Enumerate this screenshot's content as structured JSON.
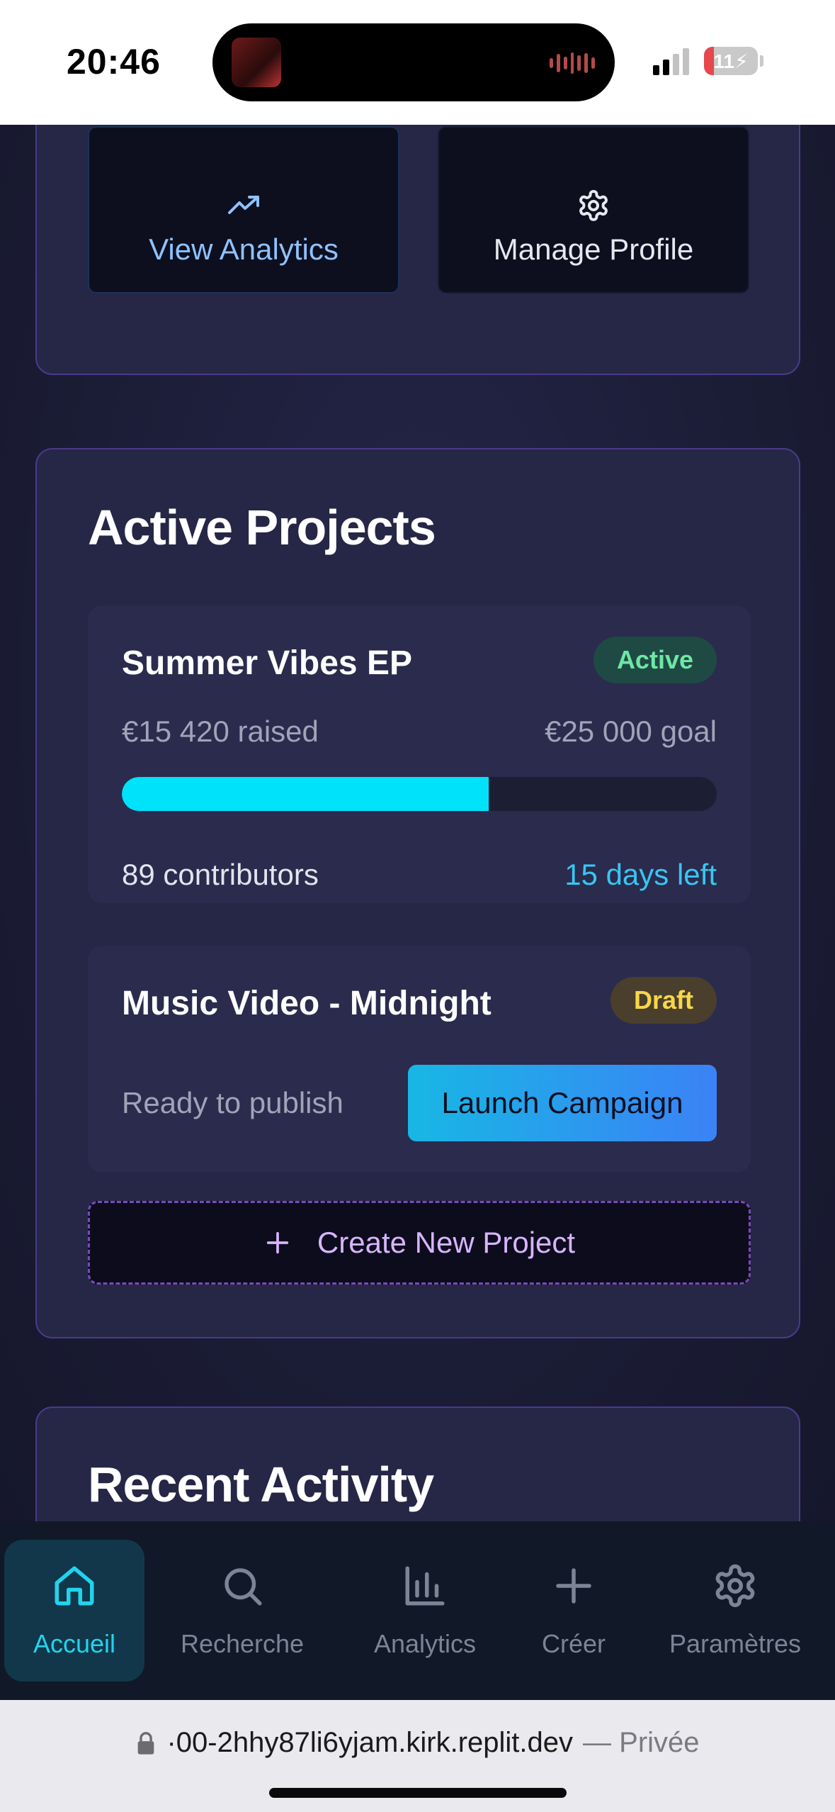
{
  "status_bar": {
    "time": "20:46",
    "battery": "11"
  },
  "quick_actions": {
    "view_analytics": "View Analytics",
    "manage_profile": "Manage Profile"
  },
  "active_projects": {
    "title": "Active Projects",
    "projects": [
      {
        "name": "Summer Vibes EP",
        "status": "Active",
        "raised": "€15 420 raised",
        "goal": "€25 000 goal",
        "progress": 0.617,
        "contributors": "89 contributors",
        "days_left": "15 days left"
      },
      {
        "name": "Music Video - Midnight",
        "status": "Draft",
        "note": "Ready to publish",
        "action": "Launch Campaign"
      }
    ],
    "create_button": "Create New Project"
  },
  "recent_activity": {
    "title": "Recent Activity"
  },
  "bottom_nav": {
    "items": [
      {
        "label": "Accueil",
        "icon": "home-icon",
        "active": true
      },
      {
        "label": "Recherche",
        "icon": "search-icon",
        "active": false
      },
      {
        "label": "Analytics",
        "icon": "bar-chart-icon",
        "active": false
      },
      {
        "label": "Créer",
        "icon": "plus-icon",
        "active": false
      },
      {
        "label": "Paramètres",
        "icon": "gear-icon",
        "active": false
      }
    ]
  },
  "browser": {
    "url": "·00-2hhy87li6yjam.kirk.replit.dev",
    "private_label": "— Privée"
  },
  "colors": {
    "accent_cyan": "#00e1fa",
    "active_green": "#6ee7a4",
    "draft_yellow": "#f8d64a",
    "purple_border": "#4a3a8a"
  }
}
